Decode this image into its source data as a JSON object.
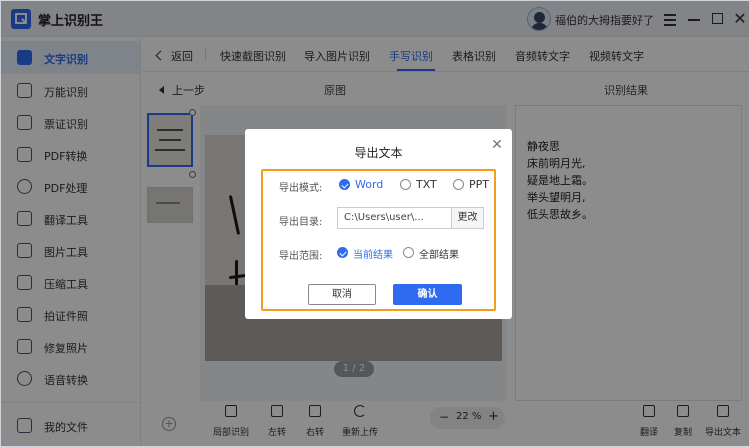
{
  "app": {
    "title": "掌上识别王",
    "user_name": "福伯的大拇指要好了"
  },
  "sidebar": {
    "items": [
      {
        "label": "文字识别",
        "icon": "text-recognition-icon"
      },
      {
        "label": "万能识别",
        "icon": "universal-scan-icon"
      },
      {
        "label": "票证识别",
        "icon": "ticket-icon"
      },
      {
        "label": "PDF转换",
        "icon": "pdf-convert-icon"
      },
      {
        "label": "PDF处理",
        "icon": "pdf-process-icon"
      },
      {
        "label": "翻译工具",
        "icon": "translate-icon"
      },
      {
        "label": "图片工具",
        "icon": "image-tool-icon"
      },
      {
        "label": "压缩工具",
        "icon": "compress-icon"
      },
      {
        "label": "拍证件照",
        "icon": "id-photo-icon"
      },
      {
        "label": "修复照片",
        "icon": "photo-repair-icon"
      },
      {
        "label": "语音转换",
        "icon": "voice-convert-icon"
      }
    ],
    "my_files": "我的文件"
  },
  "tabs": {
    "back": "返回",
    "items": [
      "快速截图识别",
      "导入图片识别",
      "手写识别",
      "表格识别",
      "音频转文字",
      "视频转文字"
    ],
    "active_index": 2
  },
  "subheader": {
    "prev_step": "上一步",
    "original": "原图",
    "result": "识别结果"
  },
  "viewer": {
    "page_indicator": "1 / 2"
  },
  "result_text": [
    "静夜思",
    "床前明月光,",
    "疑是地上霜。",
    "举头望明月,",
    "低头思故乡。"
  ],
  "bottom_tools": {
    "left": [
      "局部识别",
      "左转",
      "右转",
      "重新上传"
    ],
    "zoom": "22 %",
    "right": [
      "翻译",
      "复制",
      "导出文本"
    ]
  },
  "dialog": {
    "title": "导出文本",
    "format_label": "导出模式:",
    "format_options": [
      "Word",
      "TXT",
      "PPT"
    ],
    "format_selected": "Word",
    "dir_label": "导出目录:",
    "dir_value": "C:\\Users\\user\\...",
    "dir_button": "更改",
    "range_label": "导出范围:",
    "range_options": [
      "当前结果",
      "全部结果"
    ],
    "range_selected": "当前结果",
    "cancel": "取消",
    "confirm": "确认"
  },
  "colors": {
    "accent": "#2f6bf0",
    "highlight_border": "#f59e1b",
    "overlay": "rgba(0,0,0,0.45)"
  }
}
